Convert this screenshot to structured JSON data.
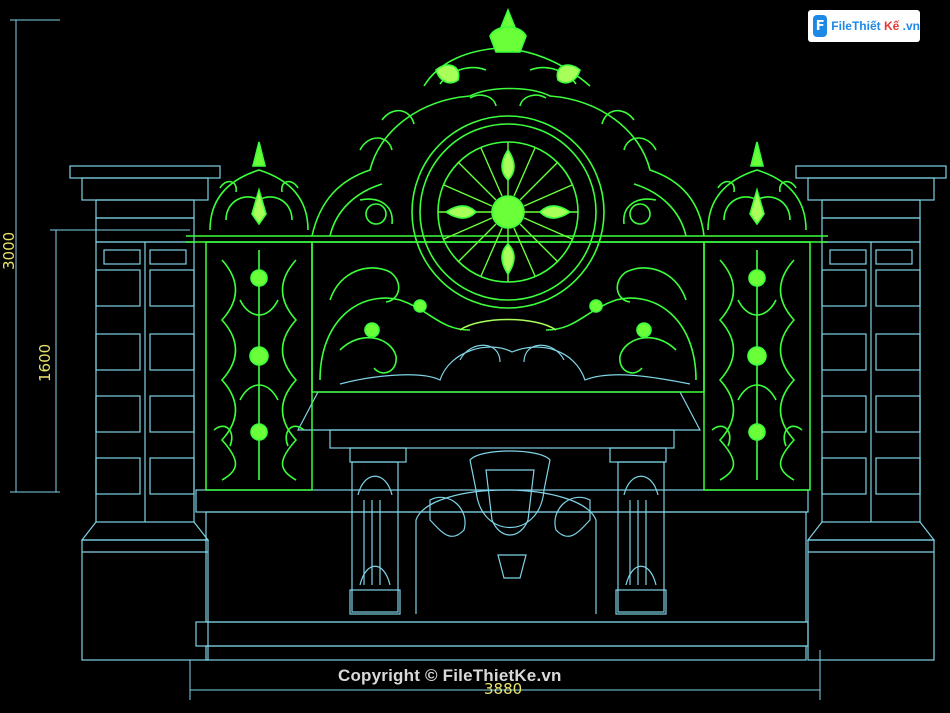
{
  "watermark": {
    "logo_initials": "F",
    "logo_text_main": "FileThiết",
    "logo_text_accent": "Kế",
    "logo_text_tld": ".vn"
  },
  "copyright": "Copyright © FileThietKe.vn",
  "dimensions": {
    "total_height": "3000",
    "fence_height": "1600",
    "width": "3880"
  },
  "colors": {
    "background": "#000000",
    "outline": "#7fd3e6",
    "ornament": "#3cff3c",
    "ornament_bright": "#a8ff5a",
    "dimension": "#e8e36c"
  }
}
